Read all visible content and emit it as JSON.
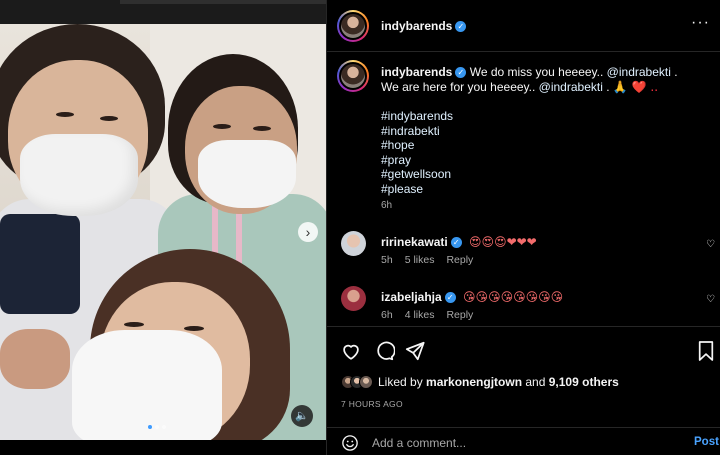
{
  "post": {
    "username": "indybarends",
    "more_icon": "ellipsis-icon",
    "caption_line1": "We do miss you heeeey.. ",
    "caption_mention1": "@indrabekti",
    "caption_line1_end": " .",
    "caption_line2": "We are here for you heeeey.. ",
    "caption_mention2": "@indrabekti",
    "caption_line2_end": " .",
    "caption_emoji": "🙏 ❤️ ..",
    "hashtags": [
      "#indybarends",
      "#indrabekti",
      "#hope",
      "#pray",
      "#getwellsoon",
      "#please"
    ],
    "caption_time": "6h"
  },
  "comments": [
    {
      "username": "ririnekawati",
      "text": "😍😍😍❤❤❤",
      "time": "5h",
      "likes": "5 likes",
      "reply": "Reply"
    },
    {
      "username": "izabeljahja",
      "text": "😘😘😘😘😘😘😘😘",
      "time": "6h",
      "likes": "4 likes",
      "reply": "Reply"
    }
  ],
  "likes": {
    "prefix": "Liked by ",
    "user": "markonengjtown",
    "middle": " and ",
    "count": "9,109 others"
  },
  "post_time": "7 HOURS AGO",
  "add_comment": {
    "placeholder": "Add a comment...",
    "post_label": "Post"
  },
  "media": {
    "carousel_dots": 3,
    "active_dot": 1
  },
  "colors": {
    "verified": "#3897f0",
    "link": "#e0f1ff",
    "post_button": "#4aa3ff",
    "secondary_text": "#a8a8a8"
  }
}
